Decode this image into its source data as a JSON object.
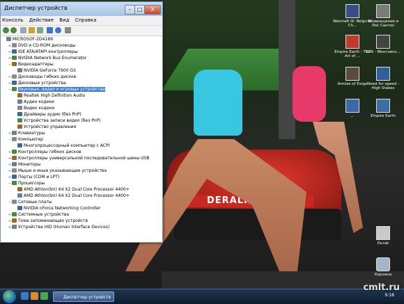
{
  "window": {
    "title": "Диспетчер устройств",
    "menu": [
      "Консоль",
      "Действие",
      "Вид",
      "Справка"
    ],
    "controls": {
      "minimize": "–",
      "maximize": "□",
      "close": "X"
    }
  },
  "tree": [
    {
      "label": "MICROSOF-2D4189",
      "level": 0,
      "expander": ""
    },
    {
      "label": "DVD и CD-ROM дисководы",
      "level": 1,
      "expander": "+"
    },
    {
      "label": "IDE ATA/ATAPI контроллеры",
      "level": 1,
      "expander": "+"
    },
    {
      "label": "NVIDIA Network Bus Enumerator",
      "level": 1,
      "expander": "+"
    },
    {
      "label": "Видеоадаптеры",
      "level": 1,
      "expander": "−"
    },
    {
      "label": "NVIDIA GeForce 7600 GS",
      "level": 2,
      "expander": ""
    },
    {
      "label": "Дисководы гибких дисков",
      "level": 1,
      "expander": "+"
    },
    {
      "label": "Дисковые устройства",
      "level": 1,
      "expander": "+"
    },
    {
      "label": "Звуковые, видео и игровые устройства",
      "level": 1,
      "expander": "−",
      "selected": true
    },
    {
      "label": "Realtek High Definition Audio",
      "level": 2,
      "expander": ""
    },
    {
      "label": "Аудио кодеки",
      "level": 2,
      "expander": ""
    },
    {
      "label": "Видео кодеки",
      "level": 2,
      "expander": ""
    },
    {
      "label": "Драйверы аудио (без PnP)",
      "level": 2,
      "expander": ""
    },
    {
      "label": "Устройства записи видео (без PnP)",
      "level": 2,
      "expander": ""
    },
    {
      "label": "Устройство управления",
      "level": 2,
      "expander": ""
    },
    {
      "label": "Клавиатуры",
      "level": 1,
      "expander": "+"
    },
    {
      "label": "Компьютер",
      "level": 1,
      "expander": "−"
    },
    {
      "label": "Многопроцессорный компьютер с ACPI",
      "level": 2,
      "expander": ""
    },
    {
      "label": "Контроллеры гибких дисков",
      "level": 1,
      "expander": "+"
    },
    {
      "label": "Контроллеры универсальной последовательной шины USB",
      "level": 1,
      "expander": "+"
    },
    {
      "label": "Мониторы",
      "level": 1,
      "expander": "+"
    },
    {
      "label": "Мыши и иные указывающие устройства",
      "level": 1,
      "expander": "+"
    },
    {
      "label": "Порты (COM и LPT)",
      "level": 1,
      "expander": "+"
    },
    {
      "label": "Процессоры",
      "level": 1,
      "expander": "−"
    },
    {
      "label": "AMD Athlon(tm) 64 X2 Dual Core Processor 4400+",
      "level": 2,
      "expander": ""
    },
    {
      "label": "AMD Athlon(tm) 64 X2 Dual Core Processor 4400+",
      "level": 2,
      "expander": ""
    },
    {
      "label": "Сетевые платы",
      "level": 1,
      "expander": "−"
    },
    {
      "label": "NVIDIA nForce Networking Controller",
      "level": 2,
      "expander": ""
    },
    {
      "label": "Системные устройства",
      "level": 1,
      "expander": "+"
    },
    {
      "label": "Тома запоминающих устройств",
      "level": 1,
      "expander": "+"
    },
    {
      "label": "Устройства HID (Human Interface Devices)",
      "level": 1,
      "expander": "+"
    }
  ],
  "desktop_icons": [
    {
      "label": "Warcraft III: Reign of Ch...",
      "color": "#3a4c8a"
    },
    {
      "label": "Возвращение в Лос Сантос",
      "color": "#7a7a7a"
    },
    {
      "label": "Empire Earth - The Art of ...",
      "color": "#c0392b"
    },
    {
      "label": "GTA - Ментовск...",
      "color": "#444444"
    },
    {
      "label": "Armies of Exigo",
      "color": "#5c4a3a"
    },
    {
      "label": "Need for speed - High Stakes",
      "color": "#2d5f9a"
    },
    {
      "label": "...",
      "color": "#3a6aa5"
    },
    {
      "label": "Empire Earth",
      "color": "#3b6fa0"
    },
    {
      "label": "Durak",
      "color": "#c9c9c9"
    },
    {
      "label": "Корзина",
      "color": "#9fb7c8"
    }
  ],
  "poster_text": "DERALTIRE.RU",
  "taskbar": {
    "task_label": "Диспетчер устройств",
    "clock": "9:18"
  },
  "watermark": "cmlt.ru",
  "colors": {
    "selection": "#3d7bd6",
    "car": "#d8302a",
    "tank_top": "#39c6e0",
    "pink_top": "#e83a6a"
  }
}
